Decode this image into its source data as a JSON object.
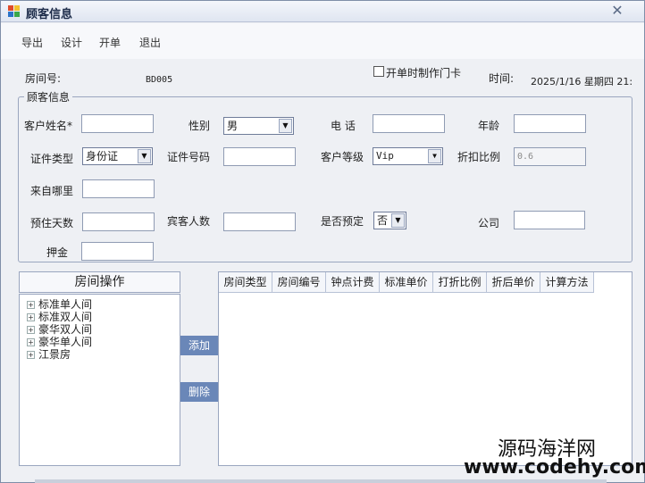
{
  "window": {
    "title": "顾客信息"
  },
  "menu": [
    "导出",
    "设计",
    "开单",
    "退出"
  ],
  "header": {
    "room_no_label": "房间号:",
    "room_no_value": "BD005",
    "make_card_label": "开单时制作门卡",
    "time_label": "时间:",
    "time_value": "2025/1/16 星期四 21:"
  },
  "group": {
    "legend": "顾客信息",
    "fields": {
      "customer_name": {
        "label": "客户姓名*",
        "value": ""
      },
      "gender": {
        "label": "性别",
        "value": "男"
      },
      "phone": {
        "label": "电  话",
        "value": ""
      },
      "age": {
        "label": "年龄",
        "value": ""
      },
      "id_type": {
        "label": "证件类型",
        "value": "身份证"
      },
      "id_number": {
        "label": "证件号码",
        "value": ""
      },
      "customer_level": {
        "label": "客户等级",
        "value": "Vip"
      },
      "discount_ratio": {
        "label": "折扣比例",
        "value": "0.6"
      },
      "origin": {
        "label": "来自哪里",
        "value": ""
      },
      "stay_days": {
        "label": "预住天数",
        "value": ""
      },
      "guest_count": {
        "label": "宾客人数",
        "value": ""
      },
      "reserved": {
        "label": "是否预定",
        "value": "否"
      },
      "company": {
        "label": "公司",
        "value": ""
      },
      "deposit": {
        "label": "押金",
        "value": ""
      }
    }
  },
  "room_panel": {
    "title": "房间操作",
    "tree": [
      "标准单人间",
      "标准双人间",
      "豪华双人间",
      "豪华单人间",
      "江景房"
    ],
    "add_label": "添加",
    "delete_label": "删除"
  },
  "grid": {
    "columns": [
      "房间类型",
      "房间编号",
      "钟点计费",
      "标准单价",
      "打折比例",
      "折后单价",
      "计算方法"
    ]
  },
  "watermark": {
    "name": "源码海洋网",
    "url": "www.codehy.com"
  },
  "colors": {
    "accent_button": "#6a87b8",
    "border": "#9aa6bf",
    "title_bg": "#dfe5f1"
  }
}
